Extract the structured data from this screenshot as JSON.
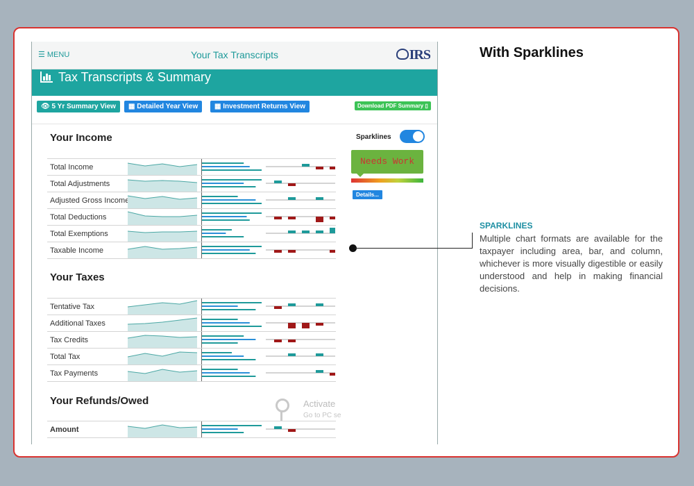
{
  "app": {
    "menu_label": "MENU",
    "title": "Your Tax Transcripts",
    "logo_text": "IRS",
    "band_title": "Tax Transcripts & Summary"
  },
  "buttons": {
    "summary5yr": "5 Yr Summary View",
    "detailed": "Detailed Year View",
    "investment": "Investment Returns View",
    "download_pdf": "Download PDF Summary"
  },
  "sections": {
    "income": {
      "title": "Your Income",
      "rows": [
        "Total Income",
        "Total Adjustments",
        "Adjusted Gross Income",
        "Total Deductions",
        "Total Exemptions",
        "Taxable Income"
      ]
    },
    "taxes": {
      "title": "Your Taxes",
      "rows": [
        "Tentative Tax",
        "Additional Taxes",
        "Tax Credits",
        "Total Tax",
        "Tax Payments"
      ]
    },
    "refunds": {
      "title": "Your Refunds/Owed",
      "rows": [
        "Amount"
      ]
    }
  },
  "sparklines_toggle": {
    "label": "Sparklines",
    "on": true
  },
  "rating": {
    "text": "Needs Work",
    "details_label": "Details..."
  },
  "watermark": {
    "line1": "Activate",
    "line2": "Go to PC se"
  },
  "panel": {
    "heading": "With Sparklines",
    "callout_title": "SPARKLINES",
    "callout_body": "Multiple chart formats are available for the taxpayer including area, bar, and column, whichever is more visually digestible or easily understood and help in making financial decisions."
  },
  "colors": {
    "teal": "#1ea5a0",
    "blue": "#2186e0",
    "border": "#d9322f",
    "neg": "#a01818"
  }
}
